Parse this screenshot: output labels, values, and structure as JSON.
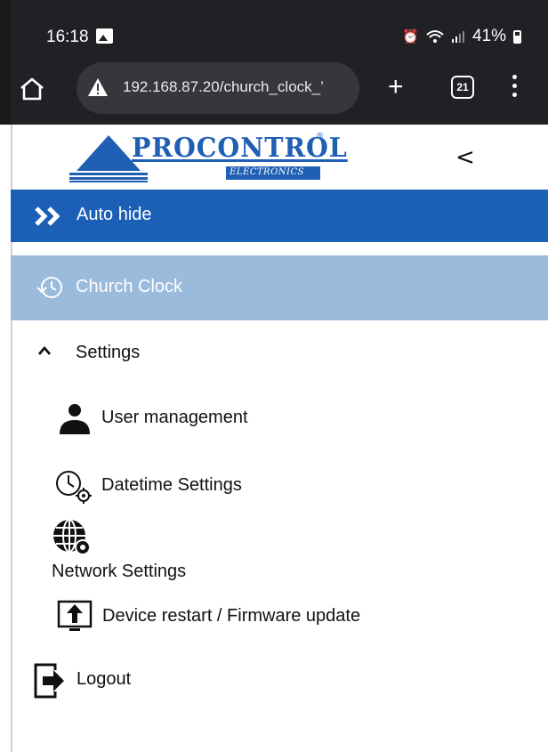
{
  "status_bar": {
    "time": "16:18",
    "battery": "41%",
    "icons": [
      "gallery-icon",
      "alarm-icon",
      "wifi-icon",
      "signal-icon",
      "battery-icon"
    ]
  },
  "browser": {
    "url": "192.168.87.20/church_clock_’",
    "tab_count": "21",
    "icons": [
      "home-icon",
      "warning-icon",
      "plus-icon",
      "tabs-icon",
      "more-vert-icon"
    ]
  },
  "header": {
    "logo_text": "PROCONTROL",
    "logo_sub": "ELECTRONICS",
    "logo_reg": "®",
    "collapse_glyph": "<"
  },
  "menu": {
    "auto_hide": "Auto hide",
    "church_clock": "Church Clock",
    "settings": {
      "label": "Settings",
      "items": [
        {
          "label": "User management",
          "icon": "user-icon"
        },
        {
          "label": "Datetime Settings",
          "icon": "clock-gear-icon"
        },
        {
          "label": "Network Settings",
          "icon": "globe-gear-icon"
        },
        {
          "label": "Device restart / Firmware update",
          "icon": "upload-icon"
        }
      ]
    },
    "logout": "Logout"
  },
  "colors": {
    "chrome": "#202124",
    "brand": "#1f5fb4",
    "auto_hide_bg": "#1b5fb7",
    "active_bg": "#9bbbdc"
  }
}
